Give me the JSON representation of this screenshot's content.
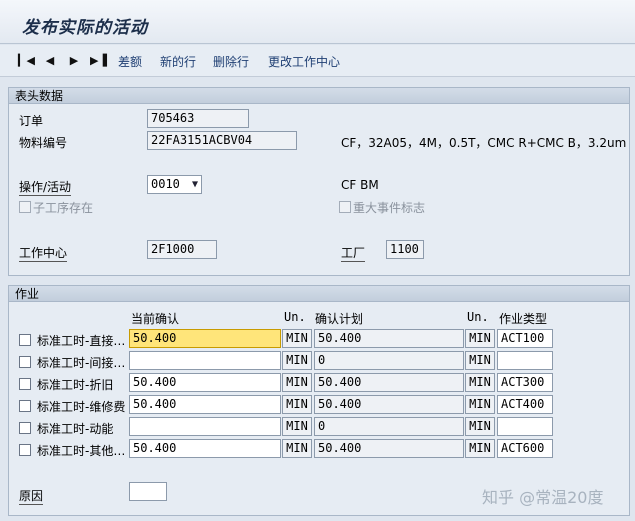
{
  "title": "发布实际的活动",
  "toolbar": {
    "links": [
      "差额",
      "新的行",
      "删除行",
      "更改工作中心"
    ]
  },
  "header_group": {
    "title": "表头数据",
    "order_label": "订单",
    "order_value": "705463",
    "material_label": "物料编号",
    "material_value": "22FA3151ACBV04",
    "material_desc": "CF，32A05，4M，0.5T，CMC R+CMC B，3.2um",
    "operation_label": "操作/活动",
    "operation_value": "0010",
    "operation_desc": "CF BM",
    "suboperation_label": "子工序存在",
    "major_event_label": "重大事件标志",
    "workcenter_label": "工作中心",
    "workcenter_value": "2F1000",
    "plant_label": "工厂",
    "plant_value": "1100"
  },
  "activity_group": {
    "title": "作业",
    "headers": {
      "current_confirm": "当前确认",
      "unit1": "Un.",
      "plan_confirm": "确认计划",
      "unit2": "Un.",
      "activity_type": "作业类型"
    },
    "rows": [
      {
        "label": "标准工时-直接…",
        "current": "50.400",
        "unit1": "MIN",
        "plan": "50.400",
        "unit2": "MIN",
        "type": "ACT100"
      },
      {
        "label": "标准工时-间接…",
        "current": "",
        "unit1": "MIN",
        "plan": "0",
        "unit2": "MIN",
        "type": ""
      },
      {
        "label": "标准工时-折旧",
        "current": "50.400",
        "unit1": "MIN",
        "plan": "50.400",
        "unit2": "MIN",
        "type": "ACT300"
      },
      {
        "label": "标准工时-维修费",
        "current": "50.400",
        "unit1": "MIN",
        "plan": "50.400",
        "unit2": "MIN",
        "type": "ACT400"
      },
      {
        "label": "标准工时-动能",
        "current": "",
        "unit1": "MIN",
        "plan": "0",
        "unit2": "MIN",
        "type": ""
      },
      {
        "label": "标准工时-其他…",
        "current": "50.400",
        "unit1": "MIN",
        "plan": "50.400",
        "unit2": "MIN",
        "type": "ACT600"
      }
    ],
    "reason_label": "原因",
    "reason_value": ""
  },
  "watermark": "知乎 @常温20度"
}
